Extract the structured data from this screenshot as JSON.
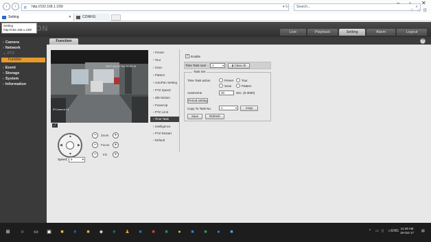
{
  "browser": {
    "url": "http://192.168.1.199/",
    "search_placeholder": "Search...",
    "tabs": [
      {
        "label": "Setting"
      },
      {
        "label": "CONFIG"
      }
    ],
    "tooltip_line1": "Setting",
    "tooltip_line2": "http://192.168.1.199/"
  },
  "app": {
    "logo": "ON",
    "main_tabs": [
      {
        "label": "Live"
      },
      {
        "label": "Playback"
      },
      {
        "label": "Setting"
      },
      {
        "label": "Alarm"
      },
      {
        "label": "Logout"
      }
    ],
    "left_menu": [
      {
        "label": "Camera"
      },
      {
        "label": "Network"
      },
      {
        "label": "PTZ"
      },
      {
        "label": "Function"
      },
      {
        "label": "Event"
      },
      {
        "label": "Storage"
      },
      {
        "label": "System"
      },
      {
        "label": "Information"
      }
    ],
    "content_title": "Function",
    "help": "?"
  },
  "video": {
    "overlay_top": "2017-10-19 Thu 11:49:31",
    "overlay_bottom": "IPCamera 01"
  },
  "ptz_controls": {
    "zoom_label": "Zoom",
    "focus_label": "Focus",
    "iris_label": "Iris",
    "minus": "−",
    "plus": "+",
    "speed_label": "Speed:",
    "speed_value": "5"
  },
  "function_menu": [
    {
      "label": "Preset"
    },
    {
      "label": "Tour"
    },
    {
      "label": "Scan"
    },
    {
      "label": "Pattern"
    },
    {
      "label": "AutoPan Setting"
    },
    {
      "label": "PTZ Speed"
    },
    {
      "label": "Idle Motion"
    },
    {
      "label": "PowerUp"
    },
    {
      "label": "PTZ Limit"
    },
    {
      "label": "Time Task"
    },
    {
      "label": "Intelligence"
    },
    {
      "label": "PTZ Restart"
    },
    {
      "label": "Default"
    }
  ],
  "time_task": {
    "enable_label": "Enable",
    "enable_checked": "✓",
    "task_num_label": "Time Task num",
    "task_num_value": "1",
    "clear_all": "Clear All",
    "task_set_legend": "Task Set",
    "action_label": "Time Task action",
    "opt_preset": "Preset",
    "opt_tour": "Tour",
    "opt_scan": "Scan",
    "opt_pattern": "Pattern",
    "autohome_label": "AutoHome",
    "autohome_value": "30",
    "autohome_unit": "Sec. (5-3600)",
    "period_setting": "Period setting",
    "copy_label": "Copy To Task No.",
    "copy_value": "1",
    "copy_btn": "Copy",
    "save_btn": "Save",
    "refresh_btn": "Refresh"
  },
  "taskbar": {
    "lang": "ENG",
    "time": "11:49 AM",
    "date": "19-Oct-17"
  }
}
